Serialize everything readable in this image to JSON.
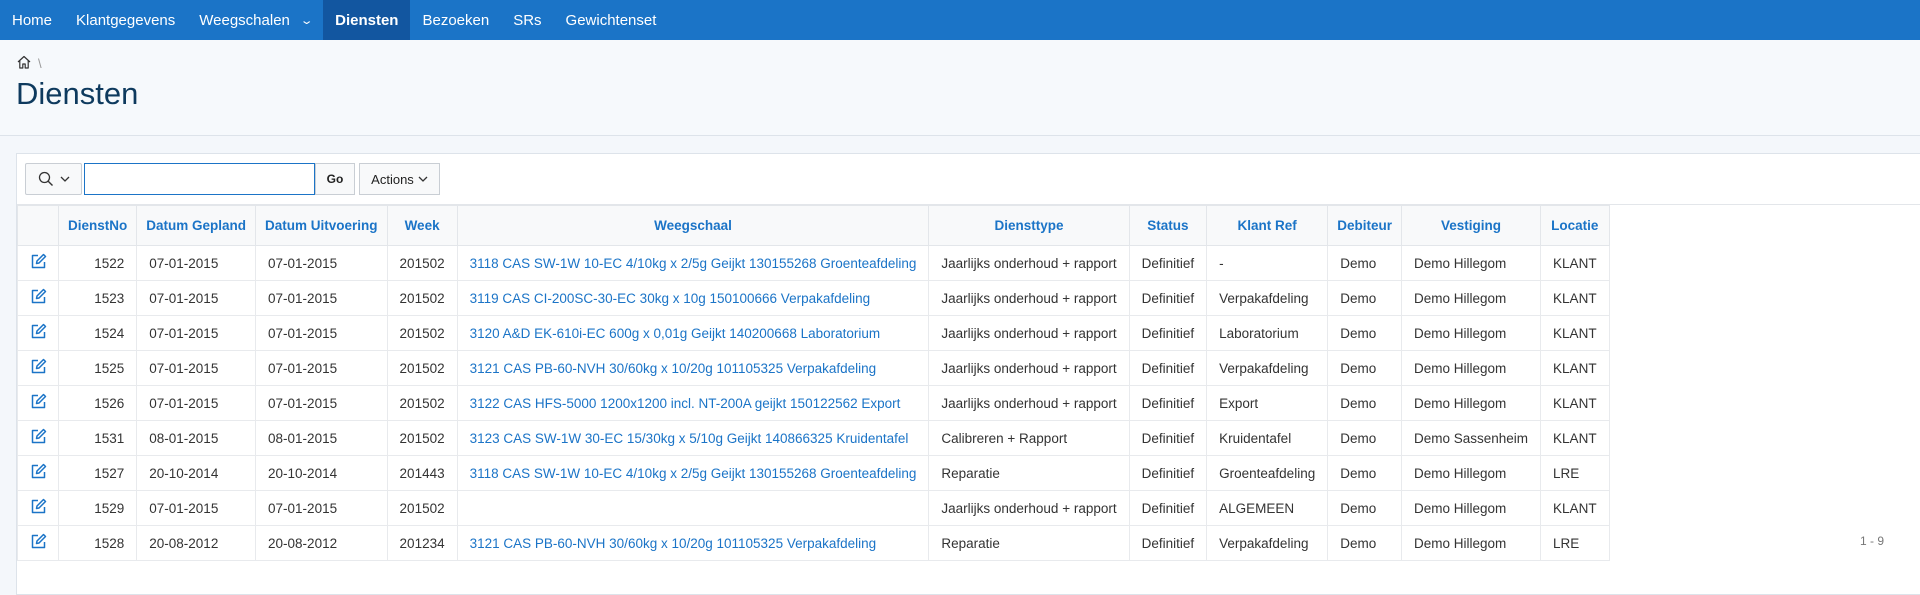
{
  "nav": {
    "items": [
      "Home",
      "Klantgegevens",
      "Weegschalen",
      "Diensten",
      "Bezoeken",
      "SRs",
      "Gewichtenset"
    ],
    "active": "Diensten"
  },
  "breadcrumb": {
    "separator": "\\"
  },
  "page": {
    "title": "Diensten"
  },
  "toolbar": {
    "go_label": "Go",
    "actions_label": "Actions",
    "search_value": ""
  },
  "table": {
    "columns": [
      "DienstNo",
      "Datum Gepland",
      "Datum Uitvoering",
      "Week",
      "Weegschaal",
      "Diensttype",
      "Status",
      "Klant Ref",
      "Debiteur",
      "Vestiging",
      "Locatie"
    ],
    "rows": [
      [
        "1522",
        "07-01-2015",
        "07-01-2015",
        "201502",
        "3118 CAS SW-1W 10-EC 4/10kg x 2/5g Geijkt 130155268 Groenteafdeling",
        "Jaarlijks onderhoud + rapport",
        "Definitief",
        "-",
        "Demo",
        "Demo Hillegom",
        "KLANT"
      ],
      [
        "1523",
        "07-01-2015",
        "07-01-2015",
        "201502",
        "3119 CAS CI-200SC-30-EC 30kg x 10g 150100666 Verpakafdeling",
        "Jaarlijks onderhoud + rapport",
        "Definitief",
        "Verpakafdeling",
        "Demo",
        "Demo Hillegom",
        "KLANT"
      ],
      [
        "1524",
        "07-01-2015",
        "07-01-2015",
        "201502",
        "3120 A&D EK-610i-EC 600g x 0,01g Geijkt 140200668 Laboratorium",
        "Jaarlijks onderhoud + rapport",
        "Definitief",
        "Laboratorium",
        "Demo",
        "Demo Hillegom",
        "KLANT"
      ],
      [
        "1525",
        "07-01-2015",
        "07-01-2015",
        "201502",
        "3121 CAS PB-60-NVH 30/60kg x 10/20g 101105325 Verpakafdeling",
        "Jaarlijks onderhoud + rapport",
        "Definitief",
        "Verpakafdeling",
        "Demo",
        "Demo Hillegom",
        "KLANT"
      ],
      [
        "1526",
        "07-01-2015",
        "07-01-2015",
        "201502",
        "3122 CAS HFS-5000 1200x1200 incl. NT-200A geijkt 150122562 Export",
        "Jaarlijks onderhoud + rapport",
        "Definitief",
        "Export",
        "Demo",
        "Demo Hillegom",
        "KLANT"
      ],
      [
        "1531",
        "08-01-2015",
        "08-01-2015",
        "201502",
        "3123 CAS SW-1W 30-EC 15/30kg x 5/10g Geijkt 140866325 Kruidentafel",
        "Calibreren + Rapport",
        "Definitief",
        "Kruidentafel",
        "Demo",
        "Demo Sassenheim",
        "KLANT"
      ],
      [
        "1527",
        "20-10-2014",
        "20-10-2014",
        "201443",
        "3118 CAS SW-1W 10-EC 4/10kg x 2/5g Geijkt 130155268 Groenteafdeling",
        "Reparatie",
        "Definitief",
        "Groenteafdeling",
        "Demo",
        "Demo Hillegom",
        "LRE"
      ],
      [
        "1529",
        "07-01-2015",
        "07-01-2015",
        "201502",
        "",
        "Jaarlijks onderhoud + rapport",
        "Definitief",
        "ALGEMEEN",
        "Demo",
        "Demo Hillegom",
        "KLANT"
      ],
      [
        "1528",
        "20-08-2012",
        "20-08-2012",
        "201234",
        "3121 CAS PB-60-NVH 30/60kg x 10/20g 101105325 Verpakafdeling",
        "Reparatie",
        "Definitief",
        "Verpakafdeling",
        "Demo",
        "Demo Hillegom",
        "LRE"
      ]
    ]
  },
  "pagination": {
    "label": "1 - 9"
  },
  "colors": {
    "nav_bg": "#1b74c7",
    "nav_active": "#1256a0",
    "link": "#1b74c7",
    "title": "#0e3a5e"
  }
}
